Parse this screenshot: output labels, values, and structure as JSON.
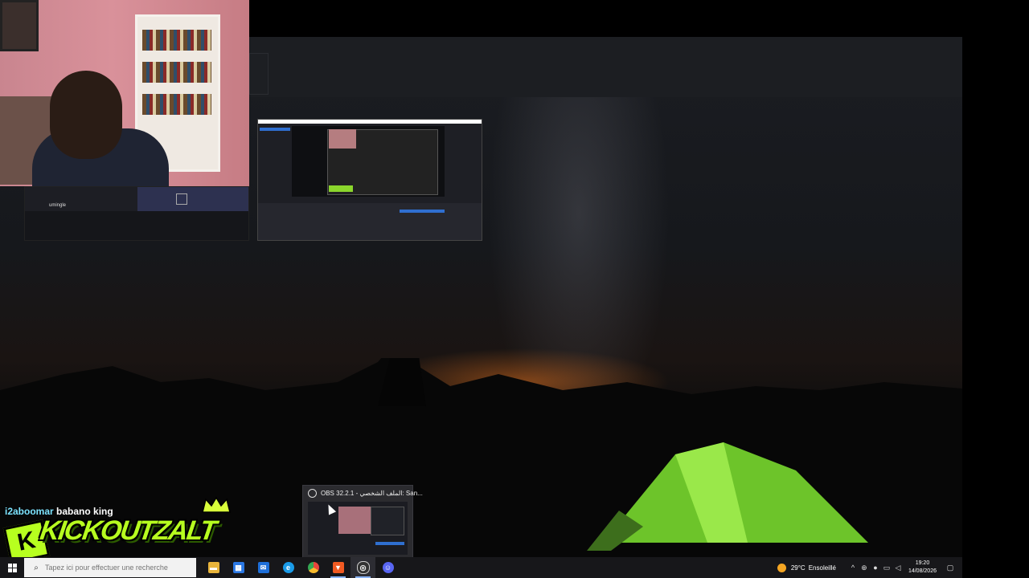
{
  "chat_overlay": {
    "user_one": "i2aboomar",
    "user_two": "babano king"
  },
  "stream_logo": {
    "badge_letter": "K",
    "text": "KICKOUTZALT"
  },
  "chat_panel": {
    "brand": "umingle"
  },
  "taskbar_preview": {
    "title": "OBS 32.2.1 - الملف الشخصي: San..."
  },
  "taskbar": {
    "search_placeholder": "Tapez ici pour effectuer une recherche",
    "apps": [
      {
        "name": "file-explorer-icon",
        "color": "#e8b43b",
        "glyph": "▬"
      },
      {
        "name": "microsoft-store-icon",
        "color": "#2b78e4",
        "glyph": "▦"
      },
      {
        "name": "mail-icon",
        "color": "#1e6fd9",
        "glyph": "✉"
      },
      {
        "name": "edge-icon",
        "color": "#1a9be8",
        "glyph": "e"
      },
      {
        "name": "chrome-icon",
        "color": "#e8453c",
        "glyph": "●"
      },
      {
        "name": "brave-icon",
        "color": "#f15a22",
        "glyph": "▼"
      },
      {
        "name": "obs-icon",
        "color": "#333333",
        "glyph": "◎"
      },
      {
        "name": "discord-icon",
        "color": "#5865f2",
        "glyph": "☺"
      }
    ],
    "weather": {
      "temp": "29°C",
      "condition": "Ensoleillé",
      "icon": "sun-icon"
    },
    "clock": {
      "time": "19:20",
      "date": "14/08/2026"
    }
  },
  "colors": {
    "logo_green": "#b7ff1f",
    "user_cyan": "#7ce3ff",
    "taskbar_bg": "#17171a",
    "tent_green": "#7dd630"
  }
}
